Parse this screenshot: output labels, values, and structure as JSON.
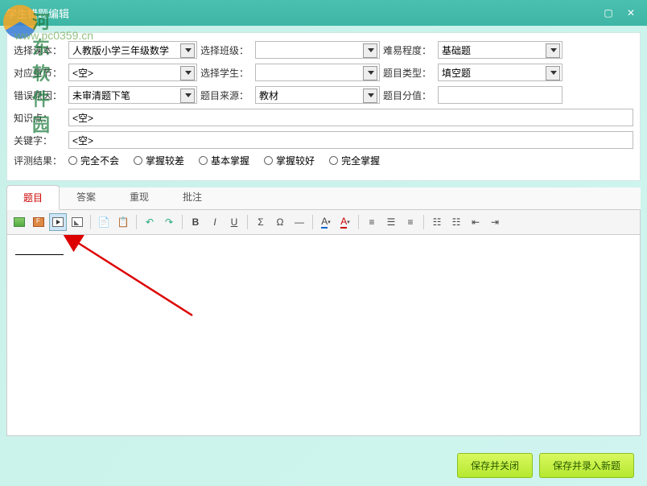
{
  "window": {
    "title": "学生错题编辑"
  },
  "watermark": {
    "site": "河东软件园",
    "url": "www.pc0359.cn"
  },
  "form": {
    "textbook_label": "选择课本：",
    "textbook_value": "人教版小学三年级数学",
    "class_label": "选择班级：",
    "class_value": "",
    "difficulty_label": "难易程度：",
    "difficulty_value": "基础题",
    "chapter_label": "对应章节：",
    "chapter_value": "<空>",
    "student_label": "选择学生：",
    "student_value": "",
    "type_label": "题目类型：",
    "type_value": "填空题",
    "reason_label": "错误原因：",
    "reason_value": "未审清题下笔",
    "source_label": "题目来源：",
    "source_value": "教材",
    "score_label": "题目分值：",
    "score_value": "",
    "knowledge_label": "知识点：",
    "knowledge_value": "<空>",
    "keyword_label": "关键字：",
    "keyword_value": "<空>",
    "result_label": "评测结果：",
    "result_options": [
      "完全不会",
      "掌握较差",
      "基本掌握",
      "掌握较好",
      "完全掌握"
    ]
  },
  "tabs": {
    "question": "题目",
    "answer": "答案",
    "redo": "重现",
    "note": "批注"
  },
  "toolbar": {
    "bold": "B",
    "italic": "I",
    "underline": "U",
    "sigma": "Σ",
    "omega": "Ω",
    "subsup": "—",
    "fgcolor": "A",
    "bgcolor": "A"
  },
  "footer": {
    "save_close": "保存并关闭",
    "save_new": "保存并录入新题"
  }
}
